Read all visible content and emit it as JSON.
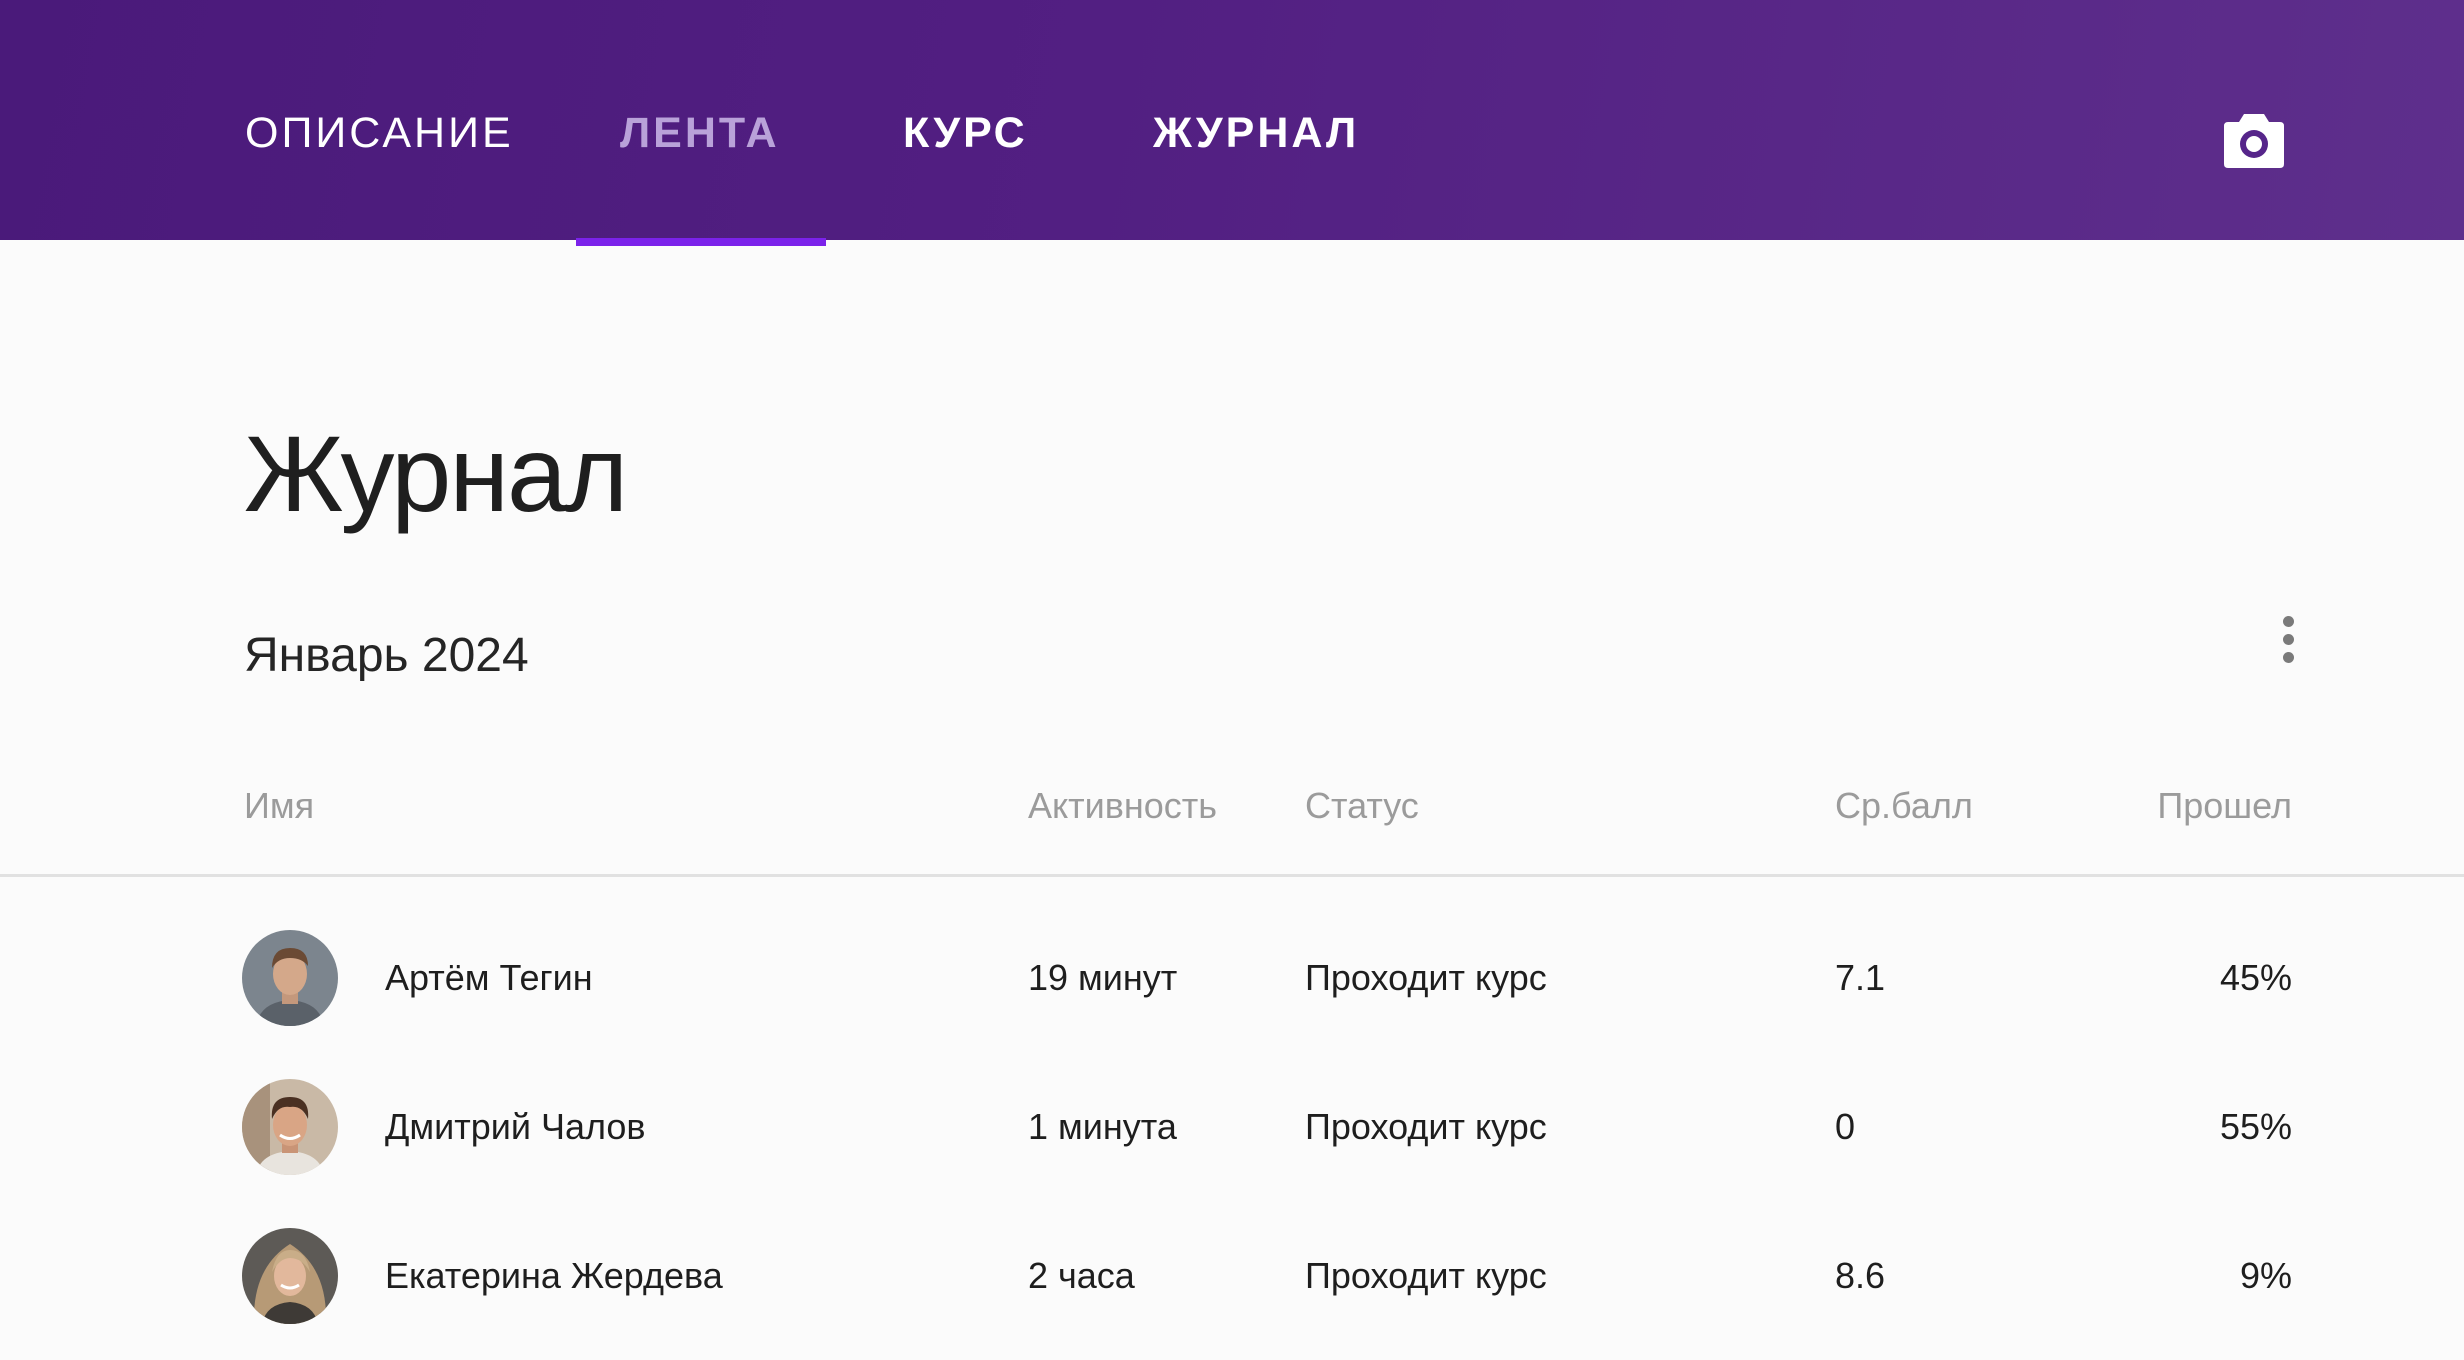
{
  "nav": {
    "tabs": [
      {
        "label": "ОПИСАНИЕ",
        "state": "normal"
      },
      {
        "label": "ЛЕНТА",
        "state": "active"
      },
      {
        "label": "КУРС",
        "state": "bold"
      },
      {
        "label": "ЖУРНАЛ",
        "state": "bold"
      }
    ],
    "camera_icon": "camera-icon"
  },
  "page": {
    "title": "Журнал",
    "period": "Январь 2024",
    "more_icon": "more-vertical-icon"
  },
  "table": {
    "columns": [
      "Имя",
      "Активность",
      "Статус",
      "Ср.балл",
      "Прошел"
    ],
    "rows": [
      {
        "name": "Артём Тегин",
        "activity": "19 минут",
        "status": "Проходит курс",
        "avg": "7.1",
        "progress": "45%"
      },
      {
        "name": "Дмитрий Чалов",
        "activity": "1 минута",
        "status": "Проходит курс",
        "avg": "0",
        "progress": "55%"
      },
      {
        "name": "Екатерина Жердева",
        "activity": "2 часа",
        "status": "Проходит курс",
        "avg": "8.6",
        "progress": "9%"
      }
    ]
  },
  "colors": {
    "header_start": "#4a1a7a",
    "header_end": "#5e2f8c",
    "active_underline": "#7b22ea",
    "active_tab_text": "#b9a2d9"
  }
}
